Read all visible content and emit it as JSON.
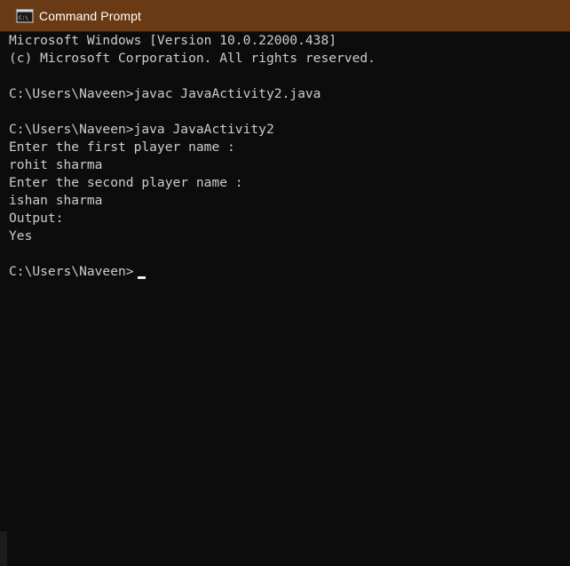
{
  "window": {
    "title": "Command Prompt",
    "icon": "cmd-icon",
    "titlebar_color": "#6a3a14",
    "background_color": "#0c0c0c",
    "text_color": "#cccccc"
  },
  "console": {
    "lines": [
      "Microsoft Windows [Version 10.0.22000.438]",
      "(c) Microsoft Corporation. All rights reserved.",
      "",
      "C:\\Users\\Naveen>javac JavaActivity2.java",
      "",
      "C:\\Users\\Naveen>java JavaActivity2",
      "Enter the first player name :",
      "rohit sharma",
      "Enter the second player name :",
      "ishan sharma",
      "Output:",
      "Yes",
      "",
      "C:\\Users\\Naveen>"
    ]
  }
}
